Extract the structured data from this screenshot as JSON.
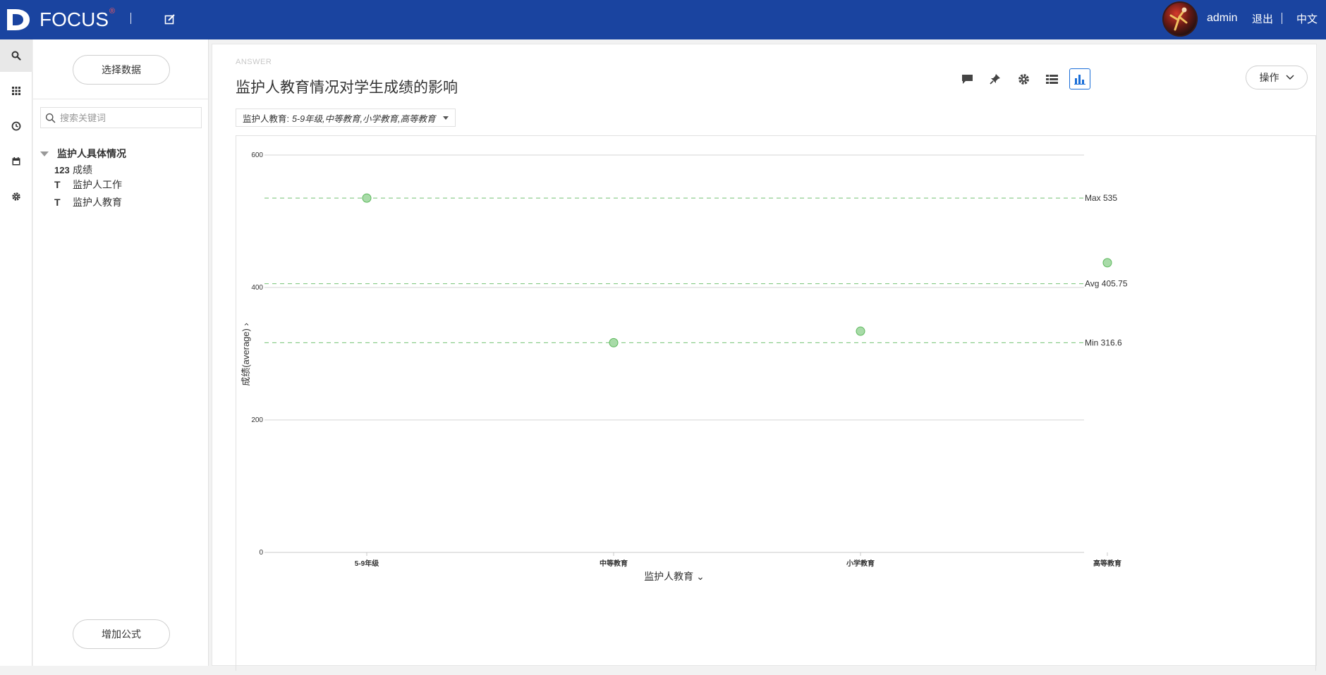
{
  "header": {
    "brand": "FOCUS",
    "brand_mark": "®",
    "user": "admin",
    "logout": "退出",
    "language": "中文"
  },
  "rail": {
    "icons": [
      "search-icon",
      "apps-grid-icon",
      "history-clock-icon",
      "calendar-icon",
      "settings-gear-icon"
    ]
  },
  "panel": {
    "select_data_label": "选择数据",
    "search_placeholder": "搜索关键词",
    "group_label": "监护人具体情况",
    "items": [
      {
        "type": "123",
        "label": "成绩"
      },
      {
        "type": "T",
        "label": "监护人工作"
      },
      {
        "type": "T",
        "label": "监护人教育"
      }
    ],
    "add_formula_label": "增加公式"
  },
  "main": {
    "answer_label": "ANSWER",
    "title": "监护人教育情况对学生成绩的影响",
    "filter_label": "监护人教育:",
    "filter_value": "5-9年级,中等教育,小学教育,高等教育",
    "toolbar": [
      "comment-icon",
      "pin-icon",
      "settings-gear-icon",
      "table-view-icon",
      "bar-chart-icon"
    ],
    "ops_label": "操作"
  },
  "chart_data": {
    "type": "scatter",
    "xlabel": "监护人教育",
    "ylabel": "成绩(average)",
    "categories": [
      "5-9年级",
      "中等教育",
      "小学教育",
      "高等教育"
    ],
    "values": [
      535,
      316.6,
      334,
      437.4
    ],
    "ylim": [
      0,
      600
    ],
    "yticks": [
      0,
      200,
      400,
      600
    ],
    "grid": true,
    "point_color": "#a8dba8",
    "point_stroke": "#5cb85c",
    "reference_lines": [
      {
        "label": "Max 535",
        "value": 535,
        "color": "#5cb85c"
      },
      {
        "label": "Avg 405.75",
        "value": 405.75,
        "color": "#5cb85c"
      },
      {
        "label": "Min 316.6",
        "value": 316.6,
        "color": "#5cb85c"
      }
    ]
  }
}
